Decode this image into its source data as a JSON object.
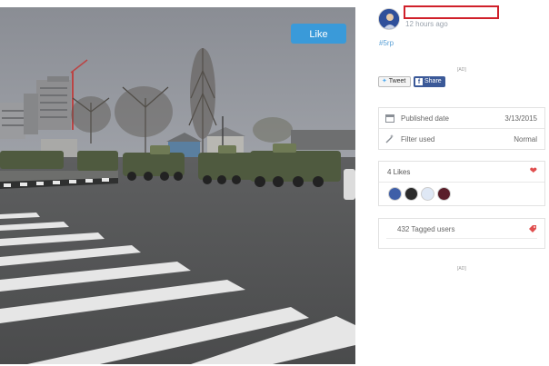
{
  "post": {
    "like_button": "Like",
    "time": "12 hours ago",
    "hashtag": "#5rp",
    "ad_label_top": "[AD]",
    "ad_label_bottom": "[AD]"
  },
  "share": {
    "tweet_label": "Tweet",
    "facebook_label": "Share"
  },
  "details": {
    "published_label": "Published date",
    "published_value": "3/13/2015",
    "filter_label": "Filter used",
    "filter_value": "Normal"
  },
  "likes": {
    "count_label": "4 Likes",
    "heart_icon": "heart-icon",
    "accent_color": "#e04e4e"
  },
  "tagged": {
    "count_label": "432 Tagged users",
    "tag_icon": "tag-icon"
  },
  "colors": {
    "like_button": "#3a9ad9",
    "hashtag": "#5aa0d6",
    "redaction": "#d0202a",
    "facebook": "#3b5998"
  }
}
